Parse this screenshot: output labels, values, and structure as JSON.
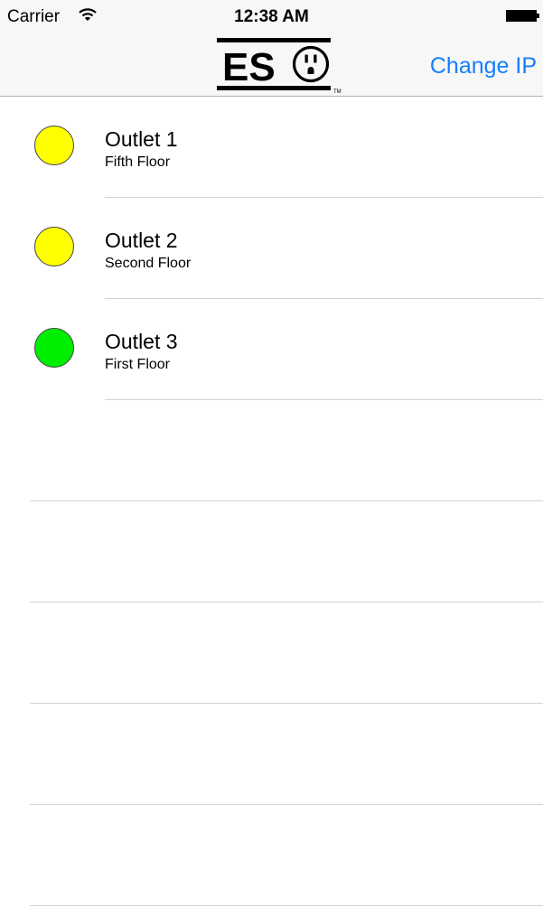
{
  "status_bar": {
    "carrier": "Carrier",
    "time": "12:38 AM",
    "wifi_icon": "wifi-icon",
    "battery_icon": "battery-full-icon"
  },
  "nav": {
    "logo_text": "ES",
    "logo_tm": "TM",
    "right_button": "Change IP"
  },
  "colors": {
    "accent": "#147efb",
    "status_yellow": "#ffff00",
    "status_green": "#00ee00"
  },
  "outlets": [
    {
      "title": "Outlet 1",
      "subtitle": "Fifth Floor",
      "status_color": "#ffff00"
    },
    {
      "title": "Outlet 2",
      "subtitle": "Second Floor",
      "status_color": "#ffff00"
    },
    {
      "title": "Outlet 3",
      "subtitle": "First Floor",
      "status_color": "#00ee00"
    }
  ]
}
